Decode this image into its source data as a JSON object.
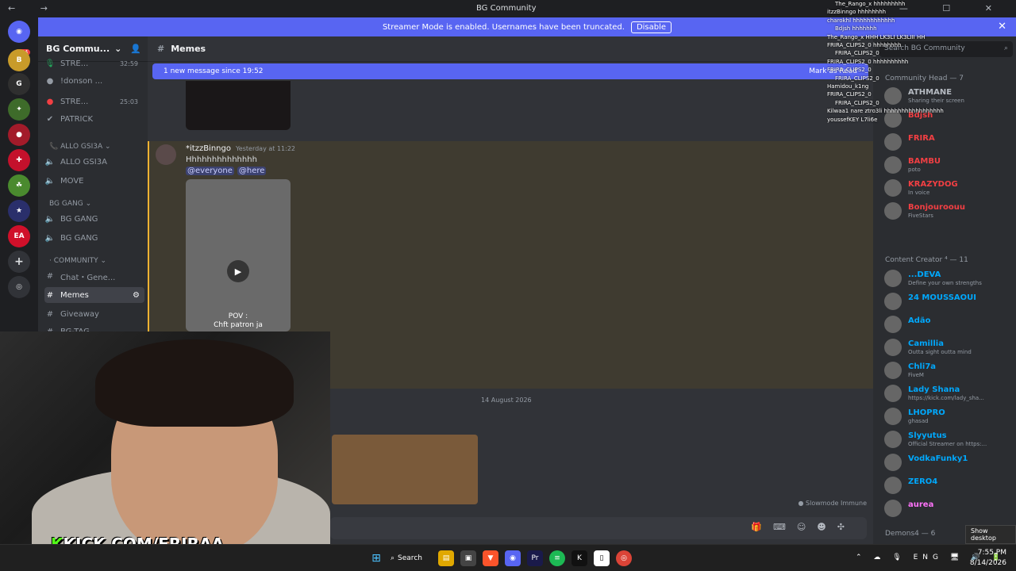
{
  "window": {
    "title": "BG Community",
    "controls": "— ☐ ✕"
  },
  "streamer": {
    "text": "Streamer Mode is enabled. Usernames have been truncated.",
    "disable": "Disable"
  },
  "servers": {
    "badge": "284"
  },
  "server": {
    "name": "BG Commu..."
  },
  "channels": {
    "voice_users": [
      {
        "name": "STRE...",
        "time": "32:59"
      },
      {
        "name": "!donson ...",
        "time": ""
      },
      {
        "name": "STRE...",
        "time": "25:03"
      },
      {
        "name": "PATRICK",
        "time": ""
      }
    ],
    "cat1": "ALLO GSI3A",
    "c1": "ALLO GSI3A",
    "c2": "MOVE",
    "cat2": "BG GANG",
    "c3": "BG GANG",
    "c4": "BG GANG",
    "cat3": "COMMUNITY",
    "c5": "Chat・Gene...",
    "c6": "Memes",
    "c7": "Giveaway",
    "c8": "BG-TAG"
  },
  "main": {
    "channel": "Memes",
    "new_message": "1 new message since 19:52",
    "mark_read": "Mark as Read",
    "author": "*itzzBinngo",
    "timestamp": "Yesterday at 11:22",
    "text": "Hhhhhhhhhhhhhh",
    "mention1": "@everyone",
    "mention2": "@here",
    "caption1": "POV :",
    "caption2": "Chft patron ja",
    "date": "14 August 2026",
    "slowmode": "Slowmode Immune"
  },
  "members": {
    "search": "Search BG Community",
    "group1": "Community Head — 7",
    "group2": "Content Creator ⁴ — 11",
    "group3": "Demons4 — 6",
    "list1": [
      {
        "name": "ATHMANE",
        "status": "Sharing their screen",
        "color": "#b5bac1"
      },
      {
        "name": "Bdjsh",
        "status": "",
        "color": "#f23f43"
      },
      {
        "name": "FRIRA",
        "status": "",
        "color": "#f23f43"
      },
      {
        "name": "BAMBU",
        "status": "poto",
        "color": "#f23f43"
      },
      {
        "name": "KRAZYDOG",
        "status": "In voice",
        "color": "#f23f43"
      },
      {
        "name": "Bonjouroouu",
        "status": "FiveStars",
        "color": "#f23f43"
      }
    ],
    "list2": [
      {
        "name": "...DEVA",
        "status": "Define your own strengths",
        "color": "#00a8fc"
      },
      {
        "name": "24 MOUSSAOUI",
        "status": "",
        "color": "#00a8fc"
      },
      {
        "name": "Adão",
        "status": "",
        "color": "#00a8fc"
      },
      {
        "name": "Camillia",
        "status": "Outta sight outta mind",
        "color": "#00a8fc"
      },
      {
        "name": "Chli7a",
        "status": "FiveM",
        "color": "#00a8fc"
      },
      {
        "name": "Lady Shana",
        "status": "https://kick.com/lady_sha...",
        "color": "#00a8fc"
      },
      {
        "name": "LHOPRO",
        "status": "ghasad",
        "color": "#00a8fc"
      },
      {
        "name": "Slyyutus",
        "status": "Official Streamer on https:...",
        "color": "#00a8fc"
      },
      {
        "name": "VodkaFunky1",
        "status": "",
        "color": "#00a8fc"
      },
      {
        "name": "ZERO4",
        "status": "",
        "color": "#00a8fc"
      },
      {
        "name": "aurea",
        "status": "",
        "color": "#ff73fa"
      }
    ]
  },
  "chat": [
    "The_Rango_x hhhhhhhhh",
    "itzzBinngo hhhhhhhh",
    "charokhl hhhhhhhhhhhh",
    "Bdjsh hhhhhhh",
    "The_Rango_x HHH LK3LI LK3LIII HH",
    "FRIRA_CLIPS2_0 hhhhhhhh",
    "FRIRA_CLIPS2_0",
    "FRIRA_CLIPS2_0 hhhhhhhhhh",
    "FRIRA_CLIPS2_0",
    "FRIRA_CLIPS2_0",
    "Hamidou_k1ng",
    "FRIRA_CLIPS2_0",
    "FRIRA_CLIPS2_0",
    "Kilwaa1 nare ztro3li hhhhhhhhhhhhhhhhh",
    "youssefKEY L7li6e"
  ],
  "webcam": {
    "kick": "KICK.COM/FRIRAA"
  },
  "taskbar": {
    "search": "Search",
    "lang": "ENG",
    "time": "7:55 PM",
    "date": "8/14/2026",
    "showdesk": "Show desktop"
  }
}
